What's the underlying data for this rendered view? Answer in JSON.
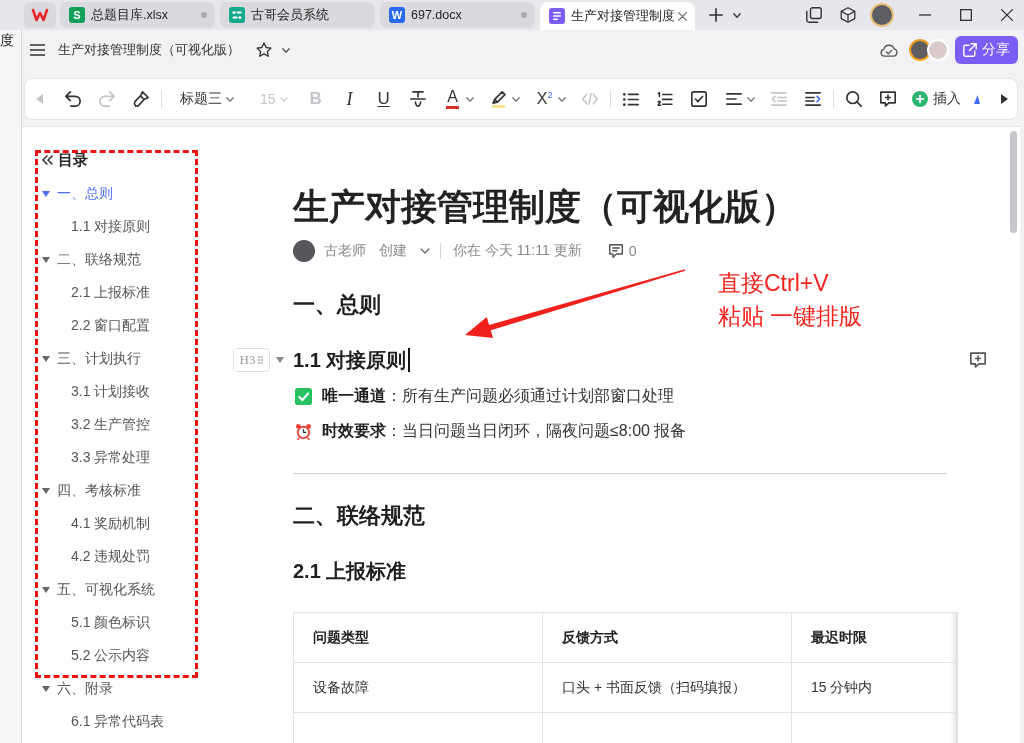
{
  "background_window": {
    "text": "度"
  },
  "tabs": [
    {
      "kind": "sheet",
      "icon_letter": "S",
      "label": "总题目库.xlsx",
      "modified": true,
      "selected": false
    },
    {
      "kind": "app",
      "label": "古哥会员系统",
      "modified": false,
      "selected": false
    },
    {
      "kind": "word",
      "icon_letter": "W",
      "label": "697.docx",
      "modified": true,
      "selected": false
    },
    {
      "kind": "doc",
      "label": "生产对接管理制度",
      "modified": false,
      "selected": true
    }
  ],
  "header_bar": {
    "title": "生产对接管理制度（可视化版）",
    "share_label": "分享"
  },
  "toolbar": [
    {
      "kind": "scroll-left",
      "disabled": true
    },
    {
      "kind": "undo",
      "disabled": false
    },
    {
      "kind": "redo",
      "disabled": true
    },
    {
      "kind": "format-painter",
      "disabled": false
    },
    {
      "kind": "separator"
    },
    {
      "kind": "dropdown",
      "label": "标题三",
      "disabled": false
    },
    {
      "kind": "dropdown",
      "label": "15",
      "disabled": true
    },
    {
      "kind": "bold",
      "glyph": "B",
      "disabled": true
    },
    {
      "kind": "italic",
      "glyph": "I",
      "disabled": false
    },
    {
      "kind": "underline",
      "glyph": "U",
      "disabled": false
    },
    {
      "kind": "strikethrough",
      "disabled": false
    },
    {
      "kind": "font-color",
      "glyph": "A",
      "color": "#d93026",
      "disabled": false
    },
    {
      "kind": "highlight",
      "color": "#f6e58d",
      "disabled": false
    },
    {
      "kind": "superscript",
      "glyph": "X$^{2}$",
      "disabled": false
    },
    {
      "kind": "code",
      "disabled": true
    },
    {
      "kind": "separator"
    },
    {
      "kind": "bullet-list",
      "disabled": false
    },
    {
      "kind": "numbered-list",
      "disabled": false
    },
    {
      "kind": "task-list",
      "disabled": false
    },
    {
      "kind": "align",
      "disabled": false
    },
    {
      "kind": "outdent",
      "disabled": true
    },
    {
      "kind": "indent",
      "disabled": false
    },
    {
      "kind": "separator"
    },
    {
      "kind": "search",
      "disabled": false
    },
    {
      "kind": "comment",
      "disabled": false
    },
    {
      "kind": "insert",
      "label": "插入",
      "disabled": false
    },
    {
      "kind": "partial"
    },
    {
      "kind": "scroll-right",
      "disabled": false
    }
  ],
  "toc": {
    "title": "目录",
    "items": [
      {
        "label": "一、总则",
        "selected": true,
        "expanded": true,
        "children": [
          {
            "label": "1.1 对接原则",
            "selected": false
          }
        ]
      },
      {
        "label": "二、联络规范",
        "selected": false,
        "expanded": true,
        "children": [
          {
            "label": "2.1 上报标准",
            "selected": false
          },
          {
            "label": "2.2 窗口配置",
            "selected": false
          }
        ]
      },
      {
        "label": "三、计划执行",
        "selected": false,
        "expanded": true,
        "children": [
          {
            "label": "3.1 计划接收",
            "selected": false
          },
          {
            "label": "3.2 生产管控",
            "selected": false
          },
          {
            "label": "3.3 异常处理",
            "selected": false
          }
        ]
      },
      {
        "label": "四、考核标准",
        "selected": false,
        "expanded": true,
        "children": [
          {
            "label": "4.1 奖励机制",
            "selected": false
          },
          {
            "label": "4.2 违规处罚",
            "selected": false
          }
        ]
      },
      {
        "label": "五、可视化系统",
        "selected": false,
        "expanded": true,
        "children": [
          {
            "label": "5.1 颜色标识",
            "selected": false
          },
          {
            "label": "5.2 公示内容",
            "selected": false
          }
        ]
      },
      {
        "label": "六、附录",
        "selected": false,
        "expanded": true,
        "children": [
          {
            "label": "6.1 异常代码表",
            "selected": false
          }
        ]
      }
    ]
  },
  "document": {
    "title": "生产对接管理制度（可视化版）",
    "author": "古老师",
    "action": "创建",
    "updated": "你在 今天 11:11 更新",
    "comment_count": "0",
    "blocks": [
      {
        "kind": "h2",
        "text": "一、总则"
      },
      {
        "kind": "h3",
        "text": "1.1 对接原则",
        "handle": "H3",
        "focused": true
      },
      {
        "kind": "check_bullet",
        "text": "**唯一通道**：所有生产问题必须通过计划部窗口处理"
      },
      {
        "kind": "alarm_bullet",
        "text": "**时效要求**：当日问题当日闭环，隔夜问题≤8:00 报备"
      },
      {
        "kind": "divider"
      },
      {
        "kind": "h2",
        "text": "二、联络规范"
      },
      {
        "kind": "h3",
        "text": "2.1 上报标准",
        "focused": false
      },
      {
        "kind": "table",
        "columns": [
          "问题类型",
          "反馈方式",
          "最迟时限"
        ],
        "rows": [
          [
            "设备故障",
            "口头 + 书面反馈（扫码填报）",
            "15 分钟内"
          ]
        ]
      }
    ]
  },
  "annotation": {
    "lines": [
      "直接Ctrl+V",
      "粘贴 一键排版"
    ]
  }
}
